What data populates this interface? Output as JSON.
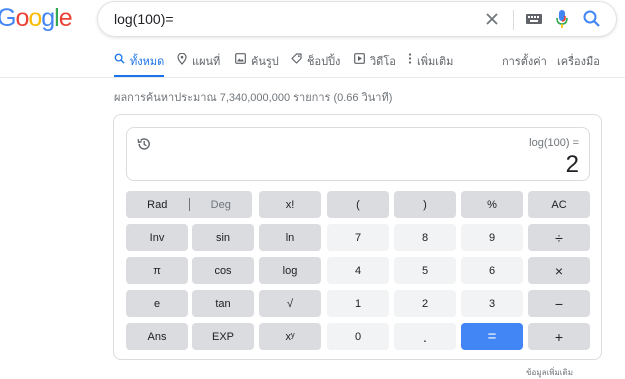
{
  "logo": {
    "letters": [
      {
        "ch": "o",
        "color": "#ea4335"
      },
      {
        "ch": "o",
        "color": "#fbbc05"
      },
      {
        "ch": "g",
        "color": "#4285f4"
      },
      {
        "ch": "l",
        "color": "#34a853"
      },
      {
        "ch": "e",
        "color": "#ea4335"
      }
    ],
    "first_letter": "G",
    "first_color": "#4285f4"
  },
  "search": {
    "query": "log(100)=",
    "icons": [
      "close-icon",
      "keyboard-icon",
      "microphone-icon",
      "search-icon"
    ]
  },
  "tabs": [
    {
      "label": "ทั้งหมด",
      "icon": "search-icon",
      "active": true
    },
    {
      "label": "แผนที่",
      "icon": "map-pin-icon"
    },
    {
      "label": "ค้นรูป",
      "icon": "image-icon"
    },
    {
      "label": "ช็อปปิ้ง",
      "icon": "tag-icon"
    },
    {
      "label": "วิดีโอ",
      "icon": "video-icon"
    },
    {
      "label": "เพิ่มเติม",
      "icon": "more-vert-icon"
    },
    {
      "label": "การตั้งค่า"
    },
    {
      "label": "เครื่องมือ"
    }
  ],
  "result_stats": "ผลการค้นหาประมาณ 7,340,000,000 รายการ (0.66 วินาที)",
  "calculator": {
    "expression": "log(100) =",
    "result": "2",
    "rad_label": "Rad",
    "deg_label": "Deg",
    "keys": [
      [
        "x!",
        "(",
        ")",
        "%",
        "AC"
      ],
      [
        "Inv",
        "sin",
        "ln",
        "7",
        "8",
        "9",
        "÷"
      ],
      [
        "π",
        "cos",
        "log",
        "4",
        "5",
        "6",
        "×"
      ],
      [
        "e",
        "tan",
        "√",
        "1",
        "2",
        "3",
        "−"
      ],
      [
        "Ans",
        "EXP",
        "xʸ",
        "0",
        ".",
        "=",
        "+"
      ]
    ]
  },
  "more_info": "ข้อมูลเพิ่มเติม",
  "colors": {
    "accent": "#1a73e8",
    "equals_key": "#4285f4",
    "function_key": "#dadce0",
    "number_key": "#f1f3f4"
  }
}
